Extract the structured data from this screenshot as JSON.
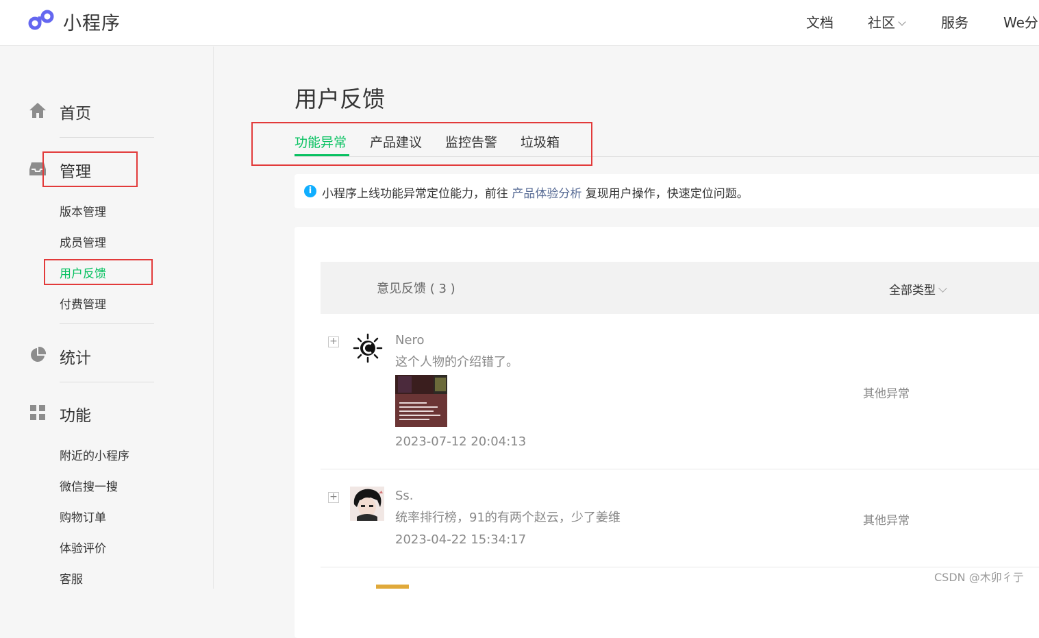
{
  "header": {
    "brand": "小程序",
    "nav": [
      "文档",
      "社区",
      "服务",
      "We分"
    ]
  },
  "sidebar": {
    "sections": [
      {
        "label": "首页",
        "icon": "home-icon"
      },
      {
        "label": "管理",
        "icon": "inbox-icon",
        "items": [
          "版本管理",
          "成员管理",
          "用户反馈",
          "付费管理"
        ],
        "active_item": "用户反馈"
      },
      {
        "label": "统计",
        "icon": "pie-chart-icon"
      },
      {
        "label": "功能",
        "icon": "grid-icon",
        "items": [
          "附近的小程序",
          "微信搜一搜",
          "购物订单",
          "体验评价",
          "客服"
        ]
      }
    ]
  },
  "main": {
    "title": "用户反馈",
    "tabs": [
      "功能异常",
      "产品建议",
      "监控告警",
      "垃圾箱"
    ],
    "active_tab": "功能异常",
    "notice": {
      "before": "小程序上线功能异常定位能力，前往",
      "link": "产品体验分析",
      "after": "复现用户操作，快速定位问题。"
    },
    "list": {
      "title": "意见反馈 ( 3 )",
      "filter": "全部类型",
      "items": [
        {
          "user": "Nero",
          "content": "这个人物的介绍错了。",
          "time": "2023-07-12 20:04:13",
          "type": "其他异常"
        },
        {
          "user": "Ss.",
          "content": "统率排行榜，91的有两个赵云，少了姜维",
          "time": "2023-04-22 15:34:17",
          "type": "其他异常"
        }
      ]
    }
  },
  "watermark": "CSDN @木卯彳亍",
  "colors": {
    "accent": "#07c160",
    "link": "#576b95",
    "highlight_box": "#e23a3a",
    "info": "#10aeff"
  }
}
